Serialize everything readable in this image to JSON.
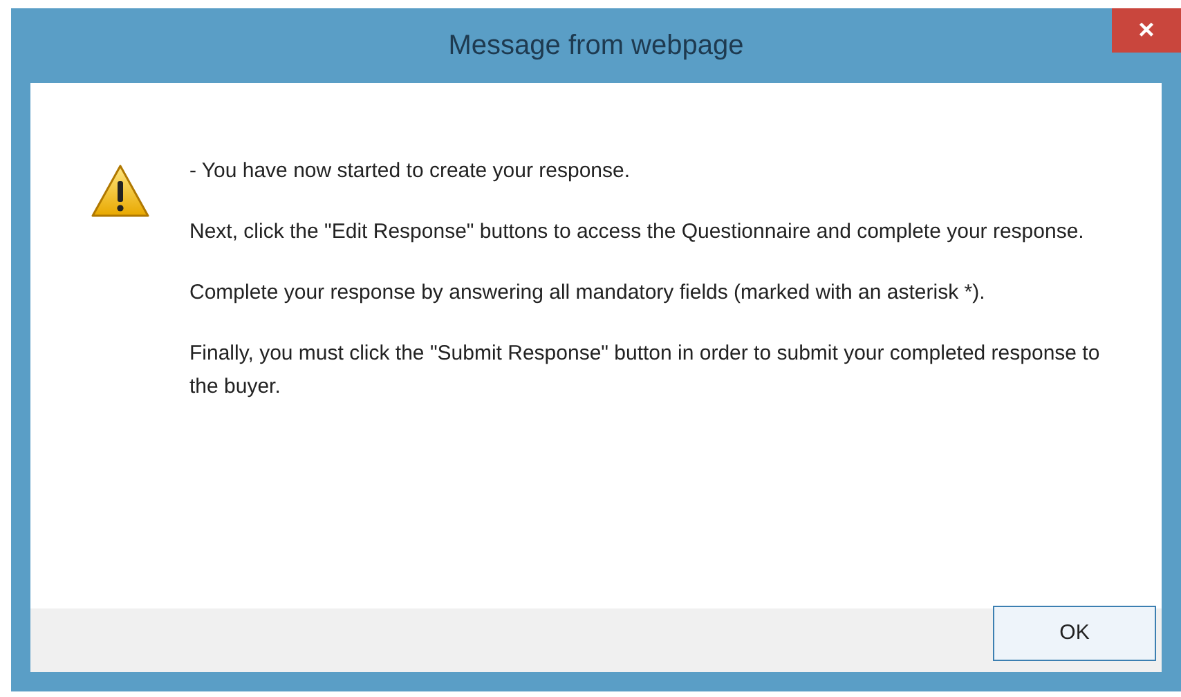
{
  "window": {
    "title": "Message from webpage",
    "close": "×"
  },
  "message": {
    "paragraphs": [
      "- You have now started to create your response.",
      "Next, click the \"Edit Response\" buttons to access the Questionnaire and complete your response.",
      "Complete your response by answering all mandatory fields (marked with an asterisk *).",
      "Finally, you must click the \"Submit Response\" button in order to submit your completed response to the buyer."
    ]
  },
  "buttons": [
    "OK"
  ]
}
